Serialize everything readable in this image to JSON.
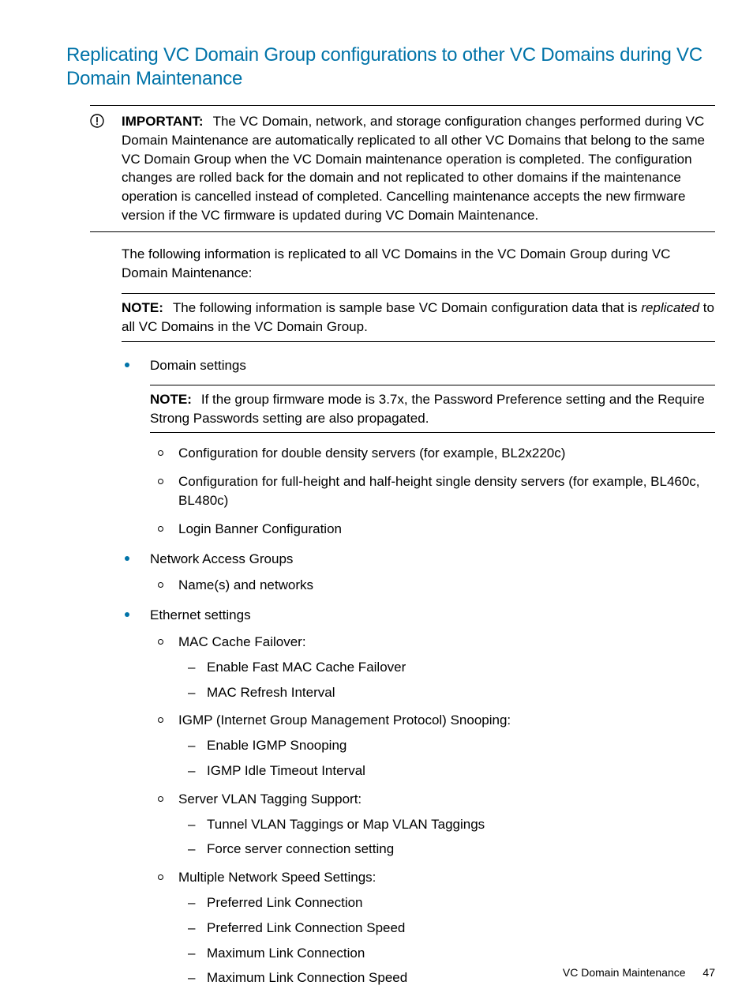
{
  "title": "Replicating VC Domain Group configurations to other VC Domains during VC Domain Maintenance",
  "important": {
    "label": "IMPORTANT:",
    "text": "The VC Domain, network, and storage configuration changes performed during VC Domain Maintenance are automatically replicated to all other VC Domains that belong to the same VC Domain Group when the VC Domain maintenance operation is completed. The configuration changes are rolled back for the domain and not replicated to other domains if the maintenance operation is cancelled instead of completed. Cancelling maintenance accepts the new firmware version if the VC firmware is updated during VC Domain Maintenance."
  },
  "intro": "The following information is replicated to all VC Domains in the VC Domain Group during VC Domain Maintenance:",
  "note1": {
    "label": "NOTE:",
    "pre": "The following information is sample base VC Domain configuration data that is ",
    "em": "replicated",
    "post": " to all VC Domains in the VC Domain Group."
  },
  "list": {
    "i0": {
      "label": "Domain settings",
      "note": {
        "label": "NOTE:",
        "text": "If the group firmware mode is 3.7x, the Password Preference setting and the Require Strong Passwords setting are also propagated."
      },
      "sub": {
        "s0": "Configuration for double density servers (for example, BL2x220c)",
        "s1": "Configuration for full-height and half-height single density servers (for example, BL460c, BL480c)",
        "s2": "Login Banner Configuration"
      }
    },
    "i1": {
      "label": "Network Access Groups",
      "sub": {
        "s0": "Name(s) and networks"
      }
    },
    "i2": {
      "label": "Ethernet settings",
      "sub": {
        "s0": {
          "label": "MAC Cache Failover:",
          "d0": "Enable Fast MAC Cache Failover",
          "d1": "MAC Refresh Interval"
        },
        "s1": {
          "label": "IGMP (Internet Group Management Protocol) Snooping:",
          "d0": "Enable IGMP Snooping",
          "d1": "IGMP Idle Timeout Interval"
        },
        "s2": {
          "label": "Server VLAN Tagging Support:",
          "d0": "Tunnel VLAN Taggings or Map VLAN Taggings",
          "d1": "Force server connection setting"
        },
        "s3": {
          "label": "Multiple Network Speed Settings:",
          "d0": "Preferred Link Connection",
          "d1": "Preferred Link Connection Speed",
          "d2": "Maximum Link Connection",
          "d3": "Maximum Link Connection Speed"
        }
      }
    }
  },
  "footer": {
    "section": "VC Domain Maintenance",
    "page": "47"
  }
}
